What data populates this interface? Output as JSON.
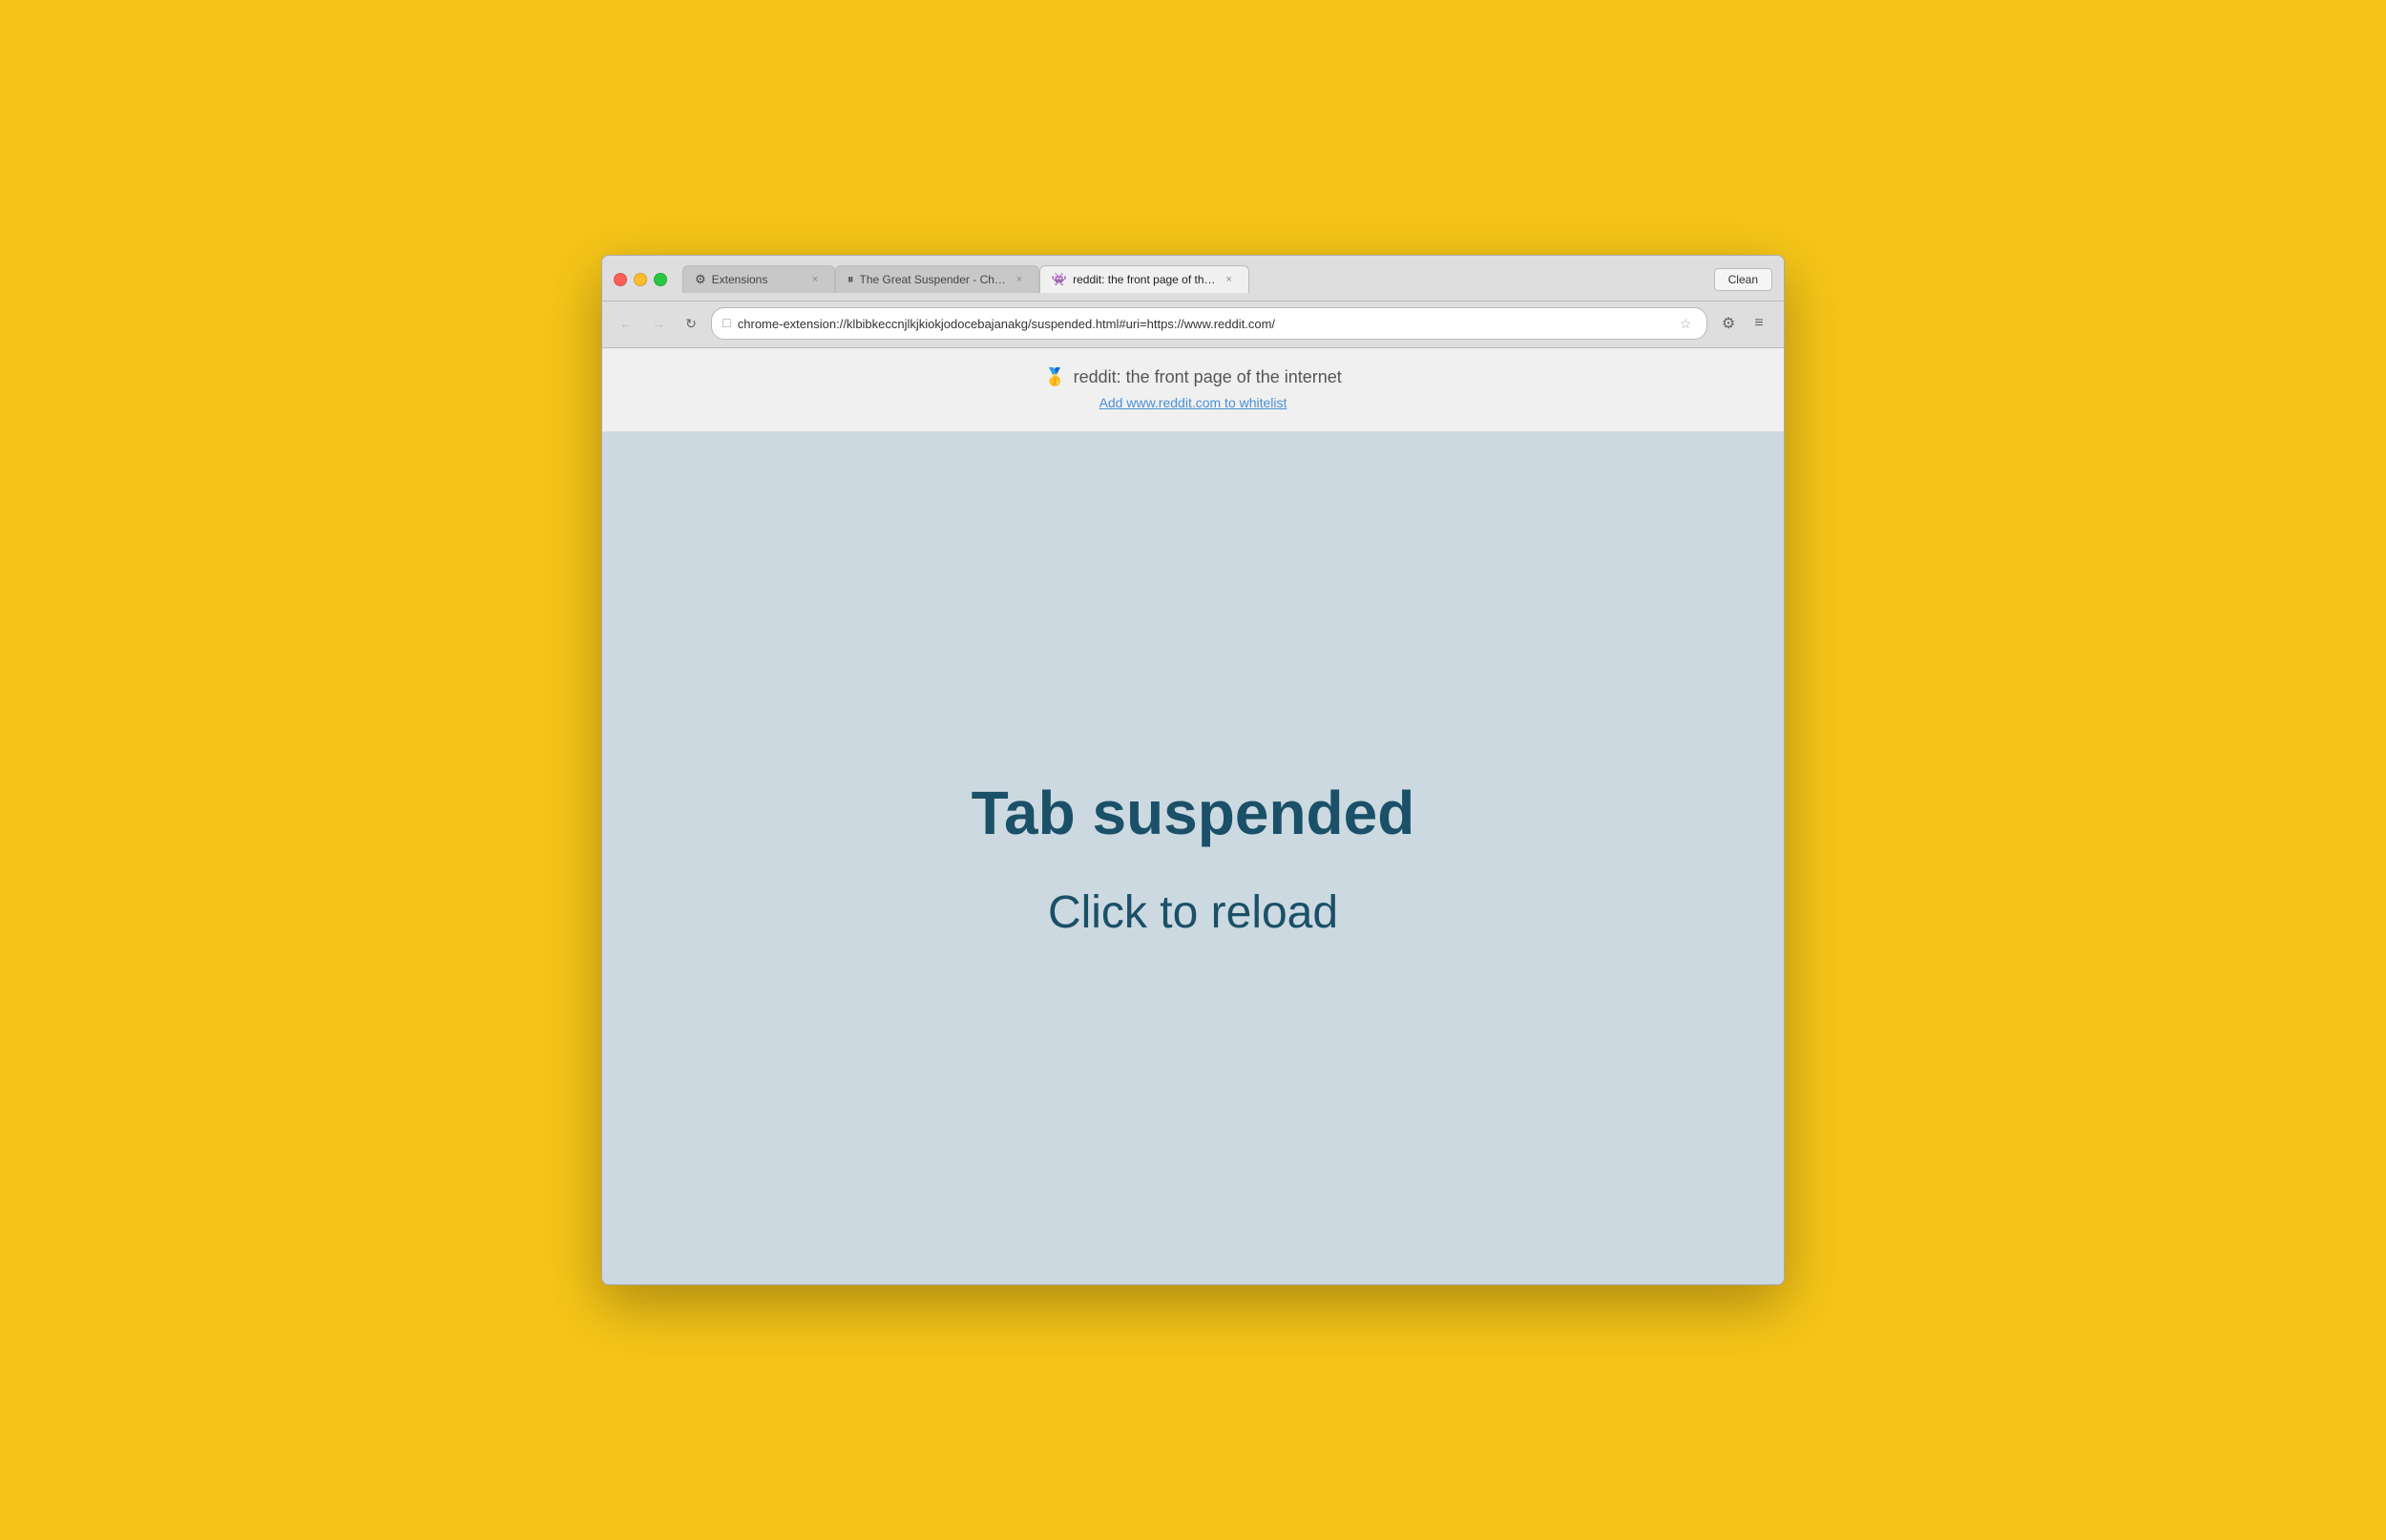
{
  "desktop": {
    "bg_color": "#F5C518"
  },
  "browser": {
    "tabs": [
      {
        "id": "tab-extensions",
        "label": "Extensions",
        "icon": "⚙",
        "active": false,
        "close_label": "×"
      },
      {
        "id": "tab-great-suspender",
        "label": "The Great Suspender - Ch…",
        "icon": "⏸",
        "active": false,
        "close_label": "×"
      },
      {
        "id": "tab-reddit",
        "label": "reddit: the front page of th…",
        "icon": "🤍",
        "active": true,
        "close_label": "×"
      }
    ],
    "clean_button_label": "Clean",
    "address_bar": {
      "url": "chrome-extension://klbibkeccnjlkjkiokjodocebajanakg/suspended.html#uri=https://www.reddit.com/",
      "icon": "🔒"
    },
    "nav": {
      "back_disabled": false,
      "forward_disabled": true
    }
  },
  "page": {
    "header": {
      "site_title": "reddit: the front page of the internet",
      "whitelist_link": "Add www.reddit.com to whitelist"
    },
    "body": {
      "suspended_title": "Tab suspended",
      "reload_text": "Click to reload"
    }
  }
}
